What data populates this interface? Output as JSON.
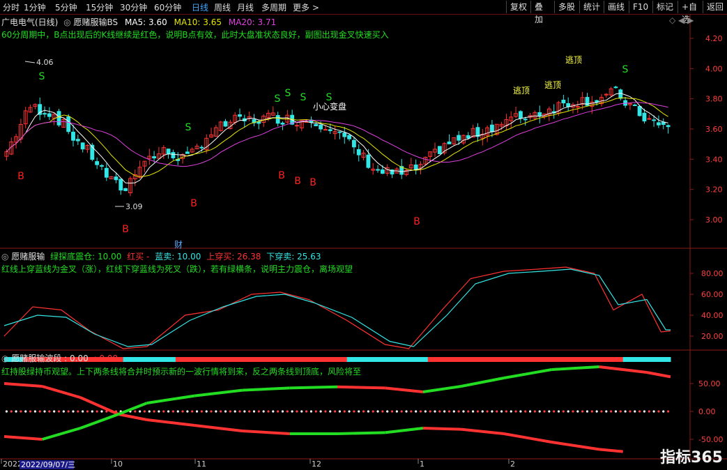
{
  "toolbar": {
    "periods": [
      "分时",
      "1分钟",
      "5分钟",
      "15分钟",
      "30分钟",
      "60分钟",
      "日线",
      "周线",
      "月线",
      "多周期",
      "更多 >"
    ],
    "active_period": "日线",
    "right_buttons": [
      "复权",
      "叠加",
      "多股",
      "统计",
      "画线",
      "F10",
      "标记",
      "+自选",
      "返回"
    ]
  },
  "main_panel": {
    "title": "广电电气(日线)",
    "indicator": "愿赌服输BS",
    "ma5": "MA5: 3.60",
    "ma10": "MA10: 3.65",
    "ma20": "MA20: 3.71",
    "tip": "60分周期中，B点出现后的K线继续是红色，说明B点有效，此时大盘准状态良好，副图出现金叉快速买入",
    "price_ticks": [
      "4.20",
      "4.00",
      "3.80",
      "3.60",
      "3.40",
      "3.20",
      "3.00"
    ],
    "high_label": "4.06",
    "low_label": "3.09",
    "caution_label": "小心变盘",
    "escape_label": "逃顶",
    "cai_label": "财",
    "buy_mark": "B",
    "sell_mark": "S"
  },
  "sub_panel1": {
    "indicator": "愿赌服输",
    "green_text": "绿探底震仓: 10.00",
    "red_text": "红买 -",
    "blue_text": "蓝卖: 10.00",
    "up_text": "上穿买: 26.38",
    "down_text": "下穿卖: 25.63",
    "tip": "红线上穿蓝线为金叉（涨），红线下穿蓝线为死叉（跌），若有绿横条，说明主力震仓，离场观望",
    "ticks": [
      "80.00",
      "60.00",
      "40.00",
      "20.00"
    ]
  },
  "sub_panel2": {
    "indicator": "愿赌服输波段",
    "value_a": ": 0.00",
    "value_b": ": 0.00",
    "tip": "红持股绿持币观望。上下两条线将合并时预示新的一波行情将到来，反之两条线到顶底，风险将至",
    "ticks": [
      "50.00",
      "0.00",
      "-50.00"
    ]
  },
  "date_axis": {
    "labels": [
      "2022",
      "10",
      "11",
      "12",
      "1",
      "2"
    ],
    "cursor_date": "2022/09/07/三"
  },
  "watermark": "指标365",
  "colors": {
    "up": "#ff3232",
    "down": "#33e6e6",
    "ma5": "#ffffff",
    "ma10": "#e6e600",
    "ma20": "#e040e0",
    "buy": "#ff2020",
    "sell": "#22dd22",
    "axis": "#8b1a1a"
  }
}
